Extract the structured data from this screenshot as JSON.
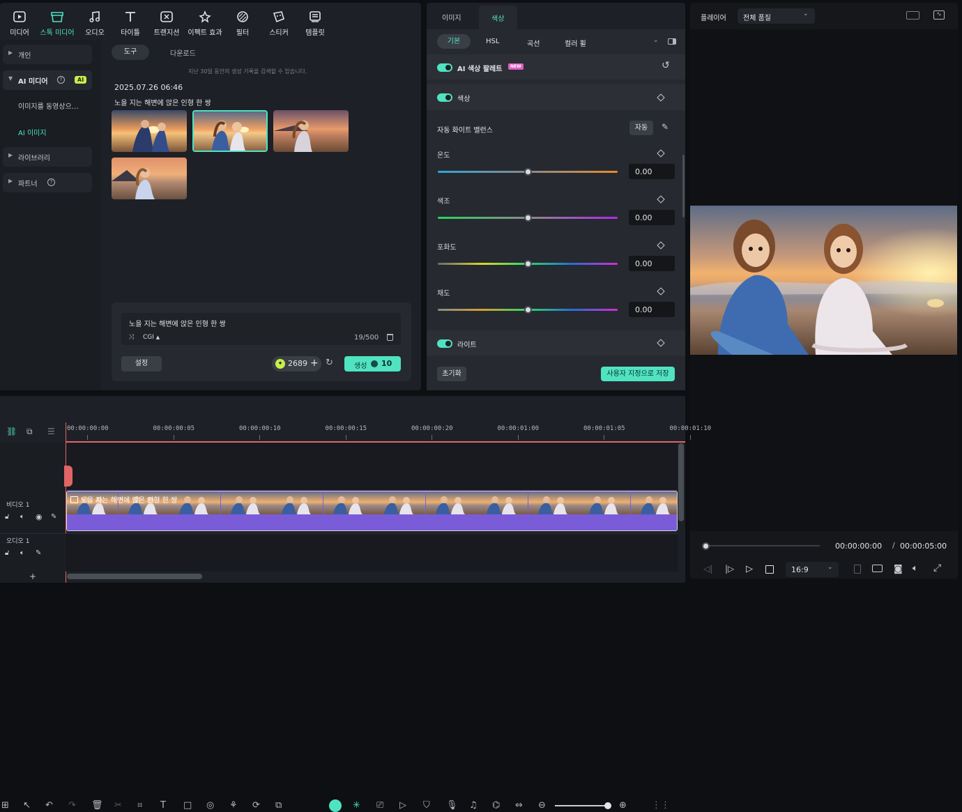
{
  "toolbar": {
    "items": [
      {
        "label": "미디어",
        "icon": "media-icon"
      },
      {
        "label": "스톡 미디어",
        "icon": "stock-media-icon"
      },
      {
        "label": "오디오",
        "icon": "audio-icon"
      },
      {
        "label": "타이틀",
        "icon": "title-icon"
      },
      {
        "label": "트랜지션",
        "icon": "transition-icon"
      },
      {
        "label": "이펙트 효과",
        "icon": "effects-icon"
      },
      {
        "label": "필터",
        "icon": "filter-icon"
      },
      {
        "label": "스티커",
        "icon": "sticker-icon"
      },
      {
        "label": "템플릿",
        "icon": "template-icon"
      }
    ]
  },
  "sidebar": {
    "personal": "개인",
    "ai_media": "AI 미디어",
    "ai_badge": "AI",
    "img_to_video": "이미지를 동영상으…",
    "ai_image": "AI 이미지",
    "library": "라이브러리",
    "partner": "파트너"
  },
  "media": {
    "tab_tools": "도구",
    "tab_download": "다운로드",
    "notice": "지난 30일 동안의 생성 기록을 검색할 수 있습니다.",
    "date": "2025.07.26 06:46",
    "prompt_title": "노을 지는 해변에 앉은 인형 한 쌍"
  },
  "prompt": {
    "text": "노을 지는 해변에 앉은 인형 한 쌍",
    "style": "CGI",
    "count": "19/500",
    "settings": "설정",
    "credits": "2689",
    "generate": "생성",
    "cost": "10"
  },
  "color": {
    "tab_image": "이미지",
    "tab_color": "색상",
    "sub_tabs": [
      "기본",
      "HSL",
      "곡선",
      "컬러 휠"
    ],
    "ai_palette": "AI 색상 팔레트",
    "new_badge": "NEW",
    "color_section": "색상",
    "auto_wb": "자동 화이트 밸런스",
    "auto_btn": "자동",
    "sliders": [
      {
        "label": "온도",
        "value": "0.00",
        "level": 0.5
      },
      {
        "label": "색조",
        "value": "0.00",
        "level": 0.5
      },
      {
        "label": "포화도",
        "value": "0.00",
        "level": 0.5
      },
      {
        "label": "채도",
        "value": "0.00",
        "level": 0.5
      }
    ],
    "light": "라이트",
    "reset": "초기화",
    "save_custom": "사용자 지정으로 저장"
  },
  "player": {
    "title": "플레이어",
    "quality": "전체 품질",
    "current": "00:00:00:00",
    "sep": "/",
    "total": "00:00:05:00",
    "ratio": "16:9"
  },
  "timeline": {
    "ruler": [
      "00:00:00:00",
      "00:00:00:05",
      "00:00:00:10",
      "00:00:00:15",
      "00:00:00:20",
      "00:00:01:00",
      "00:00:01:05",
      "00:00:01:10"
    ],
    "clip_title": "노을 지는 해변에 앉은 인형 한 쌍",
    "video_track": "비디오 1",
    "audio_track": "오디오 1",
    "zoom_level": 0.6
  }
}
